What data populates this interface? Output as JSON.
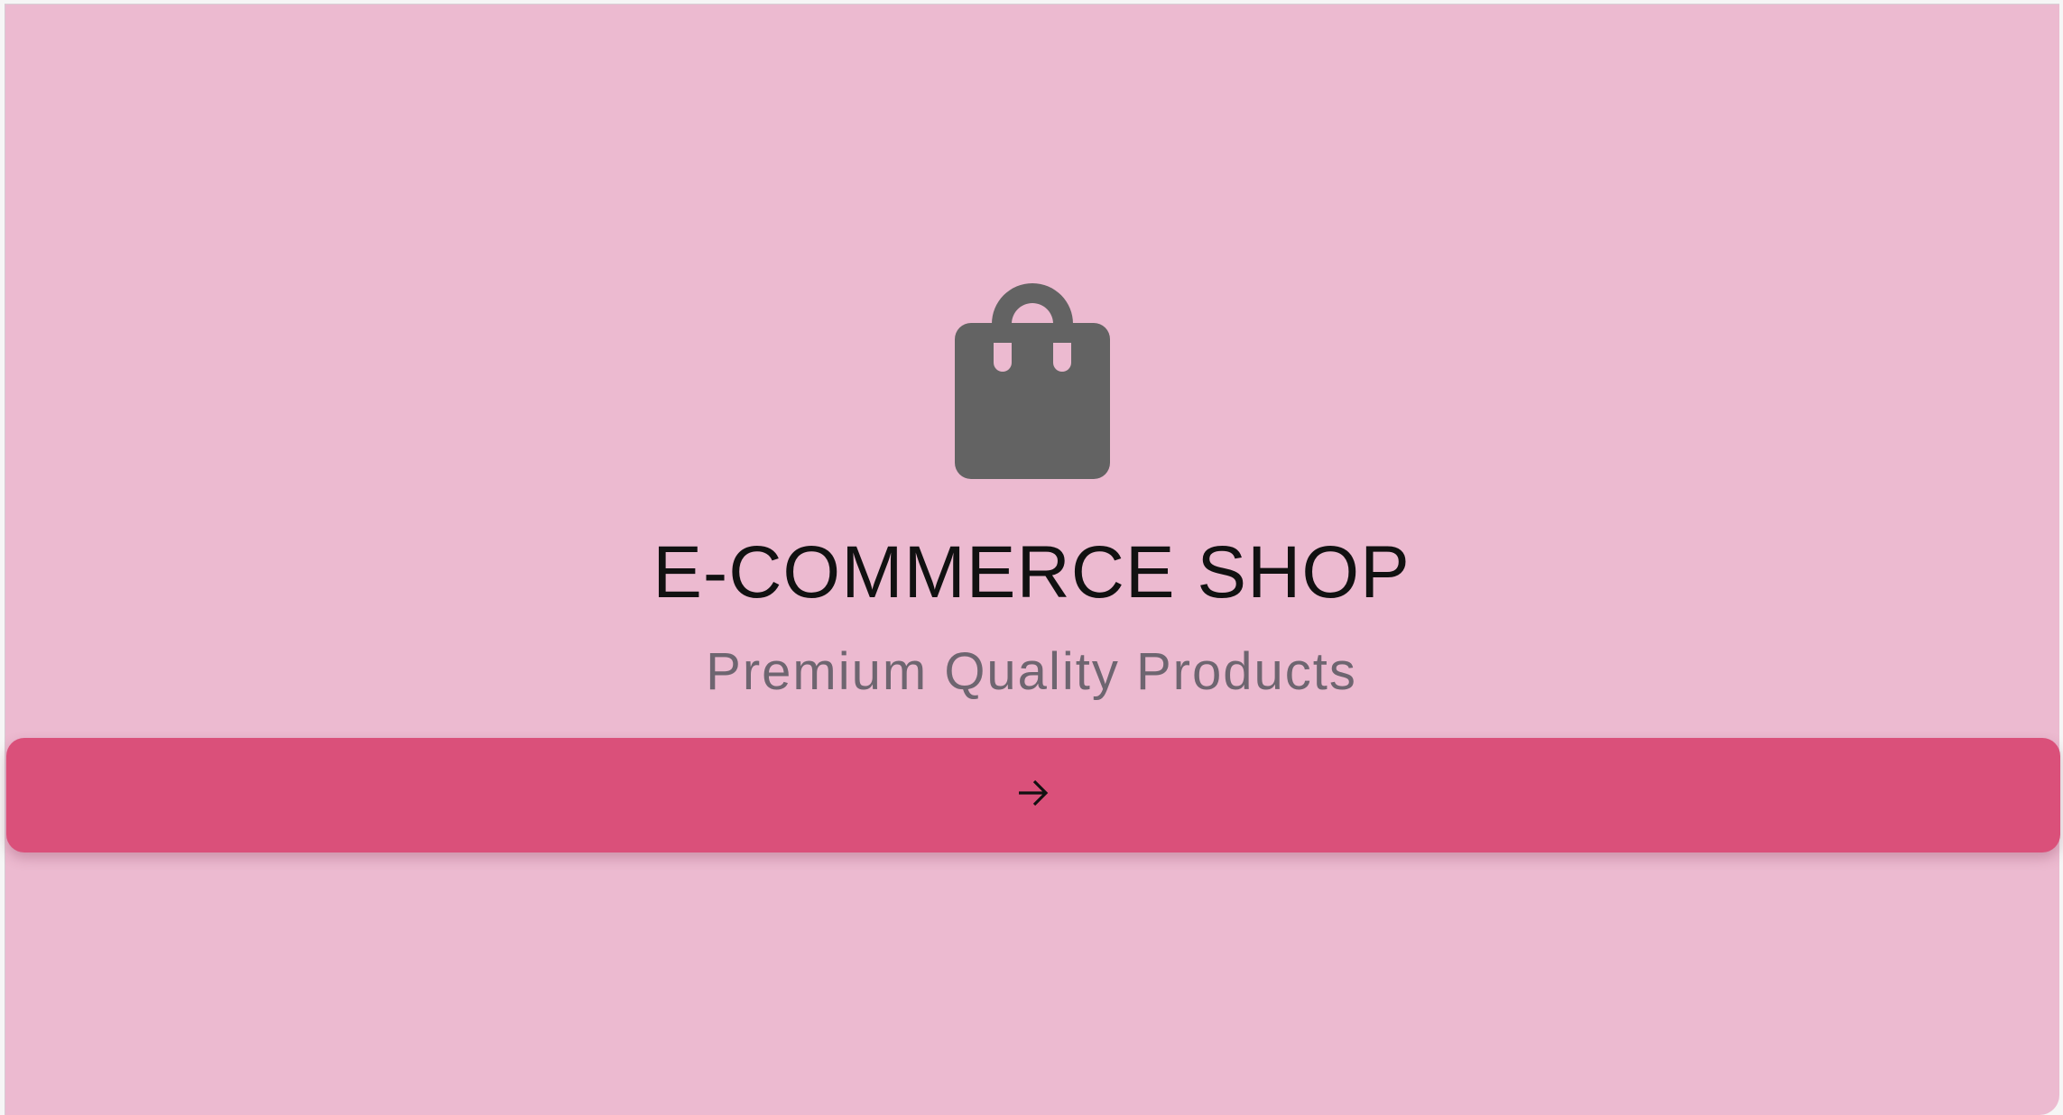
{
  "app": {
    "title": "E-COMMERCE SHOP",
    "subtitle": "Premium Quality Products"
  },
  "icons": {
    "logo": "shopping-bag-icon",
    "cta": "arrow-right-icon"
  },
  "colors": {
    "background": "#ecbad0",
    "accent": "#da507a",
    "icon": "#636363",
    "title": "#111111",
    "subtitle": "#6e6570"
  }
}
